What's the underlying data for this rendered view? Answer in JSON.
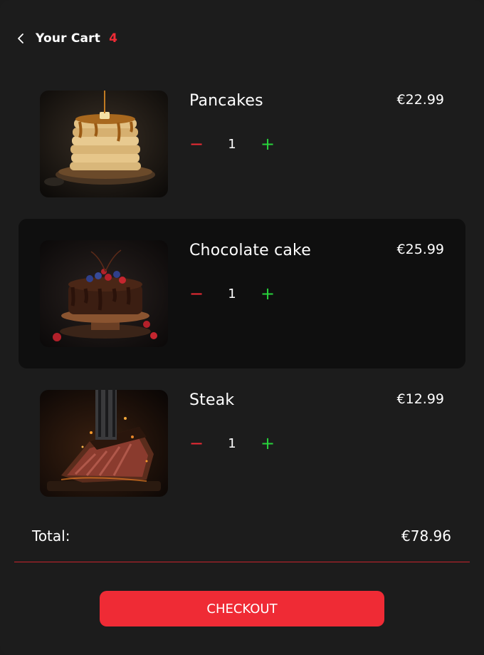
{
  "header": {
    "title": "Your Cart",
    "count": "4"
  },
  "colors": {
    "accent_red": "#ef2b35",
    "plus_green": "#27d33b",
    "background": "#1c1c1c",
    "selected_row": "#0f0f0f"
  },
  "items": [
    {
      "name": "Pancakes",
      "price": "€22.99",
      "quantity": "1",
      "minus_label": "−",
      "plus_label": "+",
      "image_icon": "pancakes-image"
    },
    {
      "name": "Chocolate cake",
      "price": "€25.99",
      "quantity": "1",
      "minus_label": "−",
      "plus_label": "+",
      "image_icon": "chocolate-cake-image"
    },
    {
      "name": "Steak",
      "price": "€12.99",
      "quantity": "1",
      "minus_label": "−",
      "plus_label": "+",
      "image_icon": "steak-image"
    }
  ],
  "summary": {
    "total_label": "Total:",
    "total_value": "€78.96"
  },
  "checkout": {
    "label": "CHECKOUT"
  }
}
